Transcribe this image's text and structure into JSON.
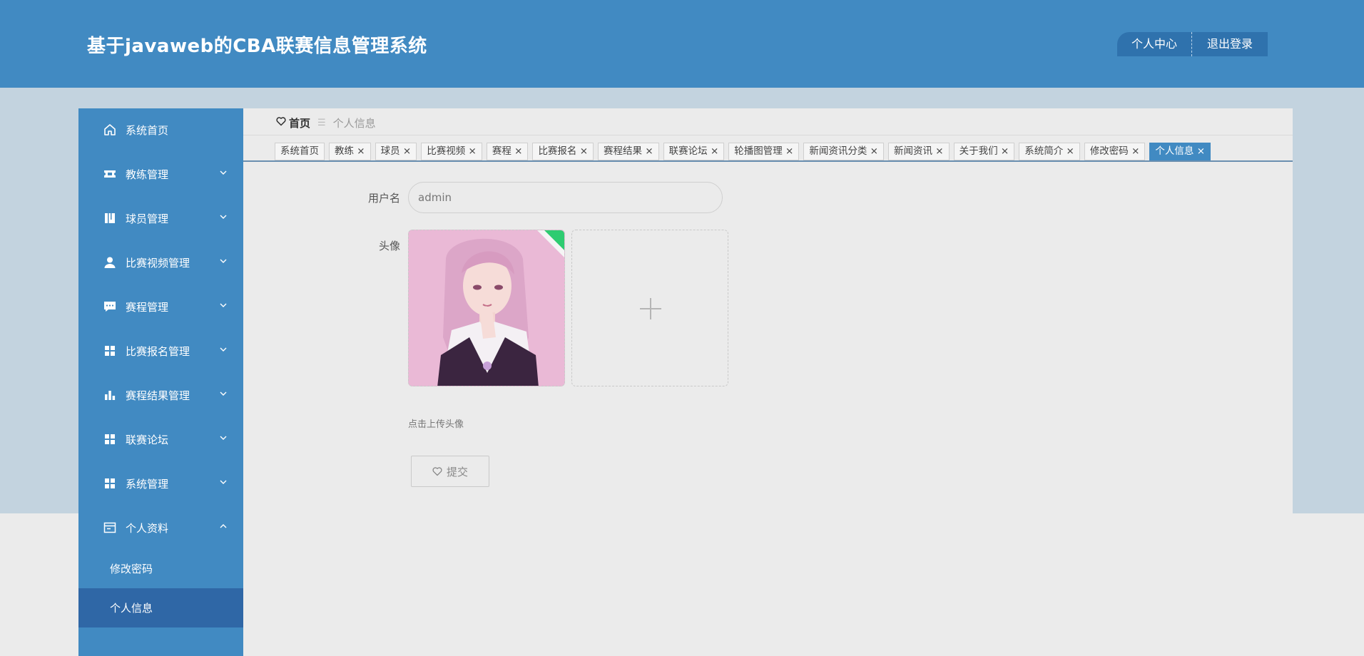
{
  "app": {
    "title": "基于javaweb的CBA联赛信息管理系统"
  },
  "header": {
    "profile_btn": "个人中心",
    "logout_btn": "退出登录"
  },
  "sidebar": {
    "items": [
      {
        "label": "系统首页",
        "icon": "home-icon"
      },
      {
        "label": "教练管理",
        "icon": "ticket-icon"
      },
      {
        "label": "球员管理",
        "icon": "book-icon"
      },
      {
        "label": "比赛视频管理",
        "icon": "user-icon"
      },
      {
        "label": "赛程管理",
        "icon": "chat-icon"
      },
      {
        "label": "比赛报名管理",
        "icon": "grid-icon"
      },
      {
        "label": "赛程结果管理",
        "icon": "bar-chart-icon"
      },
      {
        "label": "联赛论坛",
        "icon": "grid-icon"
      },
      {
        "label": "系统管理",
        "icon": "grid-icon"
      },
      {
        "label": "个人资料",
        "icon": "card-icon"
      }
    ],
    "sub_items": [
      {
        "label": "修改密码"
      },
      {
        "label": "个人信息",
        "active": true
      }
    ]
  },
  "breadcrumb": {
    "home": "首页",
    "separator": "☰",
    "current": "个人信息"
  },
  "tabs": [
    {
      "label": "系统首页"
    },
    {
      "label": "教练 ×"
    },
    {
      "label": "球员 ×"
    },
    {
      "label": "比赛视频 ×"
    },
    {
      "label": "赛程 ×"
    },
    {
      "label": "比赛报名 ×"
    },
    {
      "label": "赛程结果 ×"
    },
    {
      "label": "联赛论坛 ×"
    },
    {
      "label": "轮播图管理 ×"
    },
    {
      "label": "新闻资讯分类 ×"
    },
    {
      "label": "新闻资讯 ×"
    },
    {
      "label": "关于我们 ×"
    },
    {
      "label": "系统简介 ×"
    },
    {
      "label": "修改密码 ×"
    },
    {
      "label": "个人信息 ×",
      "active": true
    }
  ],
  "form": {
    "username_label": "用户名",
    "username_value": "admin",
    "avatar_label": "头像",
    "upload_hint": "点击上传头像",
    "submit_label": "提交"
  },
  "colors": {
    "primary": "#418ac2",
    "active_sub": "#2f67a6",
    "band": "#c3d3df",
    "background": "#ebebeb"
  }
}
